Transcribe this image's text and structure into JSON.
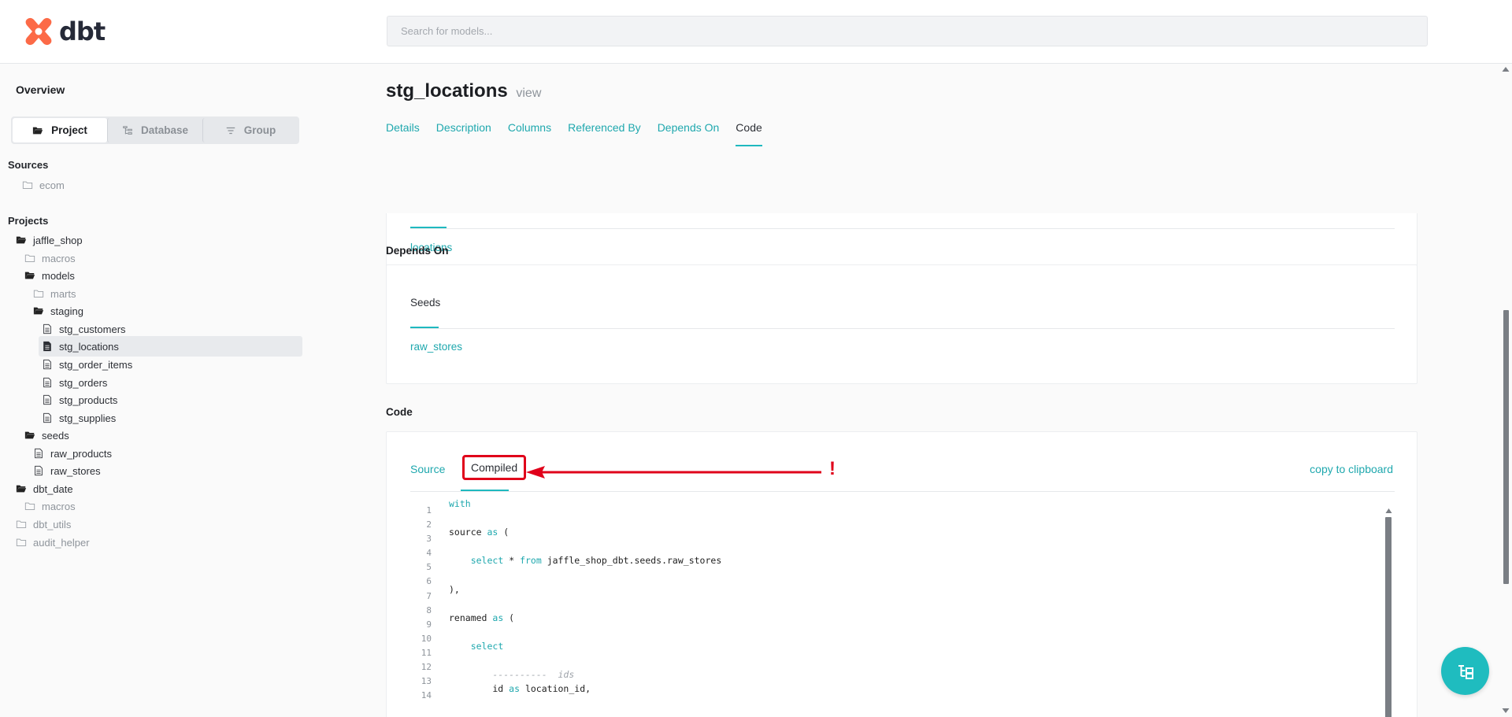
{
  "header": {
    "logo_text": "dbt",
    "search_placeholder": "Search for models..."
  },
  "sidebar": {
    "overview": "Overview",
    "switcher": [
      {
        "label": "Project",
        "icon": "folder-open-icon",
        "active": true
      },
      {
        "label": "Database",
        "icon": "tree-icon",
        "active": false
      },
      {
        "label": "Group",
        "icon": "filter-icon",
        "active": false
      }
    ],
    "sources_title": "Sources",
    "sources": [
      {
        "label": "ecom"
      }
    ],
    "projects_title": "Projects",
    "tree": [
      {
        "label": "jaffle_shop",
        "kind": "folder-open"
      },
      {
        "label": "macros",
        "kind": "folder"
      },
      {
        "label": "models",
        "kind": "folder-open"
      },
      {
        "label": "marts",
        "kind": "folder"
      },
      {
        "label": "staging",
        "kind": "folder-open"
      },
      {
        "label": "stg_customers",
        "kind": "file"
      },
      {
        "label": "stg_locations",
        "kind": "file-selected"
      },
      {
        "label": "stg_order_items",
        "kind": "file"
      },
      {
        "label": "stg_orders",
        "kind": "file"
      },
      {
        "label": "stg_products",
        "kind": "file"
      },
      {
        "label": "stg_supplies",
        "kind": "file"
      },
      {
        "label": "seeds",
        "kind": "folder-open"
      },
      {
        "label": "raw_products",
        "kind": "file"
      },
      {
        "label": "raw_stores",
        "kind": "file"
      },
      {
        "label": "dbt_date",
        "kind": "folder-open"
      },
      {
        "label": "macros",
        "kind": "folder"
      },
      {
        "label": "dbt_utils",
        "kind": "folder"
      },
      {
        "label": "audit_helper",
        "kind": "folder"
      }
    ]
  },
  "main": {
    "title": "stg_locations",
    "kind": "view",
    "tabs": [
      "Details",
      "Description",
      "Columns",
      "Referenced By",
      "Depends On",
      "Code"
    ],
    "referenced_link": "locations",
    "depends_on_title": "Depends On",
    "depends_seeds_label": "Seeds",
    "depends_link": "raw_stores",
    "code_title": "Code",
    "code_tabs": {
      "source": "Source",
      "compiled": "Compiled"
    },
    "copy_label": "copy to clipboard",
    "annotation": "!",
    "code_lines": [
      {
        "n": "1",
        "text": "with"
      },
      {
        "n": "2",
        "text": ""
      },
      {
        "n": "3",
        "text": "source as ("
      },
      {
        "n": "4",
        "text": ""
      },
      {
        "n": "5",
        "text": "    select * from jaffle_shop_dbt.seeds.raw_stores"
      },
      {
        "n": "6",
        "text": ""
      },
      {
        "n": "7",
        "text": "),"
      },
      {
        "n": "8",
        "text": ""
      },
      {
        "n": "9",
        "text": "renamed as ("
      },
      {
        "n": "10",
        "text": ""
      },
      {
        "n": "11",
        "text": "    select"
      },
      {
        "n": "12",
        "text": ""
      },
      {
        "n": "13",
        "text": "        ----------  ids"
      },
      {
        "n": "14",
        "text": "        id as location_id,"
      }
    ]
  },
  "colors": {
    "accent": "#1fa8ae",
    "highlight": "#e0001a",
    "logo": "#fc6a47"
  }
}
